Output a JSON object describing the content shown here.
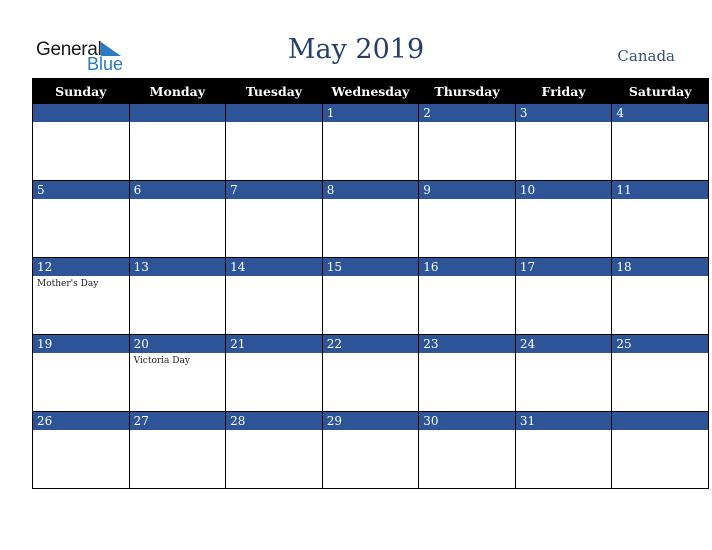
{
  "logo": {
    "line1": "General",
    "line2": "Blue"
  },
  "header": {
    "title": "May 2019",
    "country": "Canada"
  },
  "weekdays": [
    "Sunday",
    "Monday",
    "Tuesday",
    "Wednesday",
    "Thursday",
    "Friday",
    "Saturday"
  ],
  "weeks": [
    [
      {
        "day": "",
        "event": ""
      },
      {
        "day": "",
        "event": ""
      },
      {
        "day": "",
        "event": ""
      },
      {
        "day": "1",
        "event": ""
      },
      {
        "day": "2",
        "event": ""
      },
      {
        "day": "3",
        "event": ""
      },
      {
        "day": "4",
        "event": ""
      }
    ],
    [
      {
        "day": "5",
        "event": ""
      },
      {
        "day": "6",
        "event": ""
      },
      {
        "day": "7",
        "event": ""
      },
      {
        "day": "8",
        "event": ""
      },
      {
        "day": "9",
        "event": ""
      },
      {
        "day": "10",
        "event": ""
      },
      {
        "day": "11",
        "event": ""
      }
    ],
    [
      {
        "day": "12",
        "event": "Mother's Day"
      },
      {
        "day": "13",
        "event": ""
      },
      {
        "day": "14",
        "event": ""
      },
      {
        "day": "15",
        "event": ""
      },
      {
        "day": "16",
        "event": ""
      },
      {
        "day": "17",
        "event": ""
      },
      {
        "day": "18",
        "event": ""
      }
    ],
    [
      {
        "day": "19",
        "event": ""
      },
      {
        "day": "20",
        "event": "Victoria Day"
      },
      {
        "day": "21",
        "event": ""
      },
      {
        "day": "22",
        "event": ""
      },
      {
        "day": "23",
        "event": ""
      },
      {
        "day": "24",
        "event": ""
      },
      {
        "day": "25",
        "event": ""
      }
    ],
    [
      {
        "day": "26",
        "event": ""
      },
      {
        "day": "27",
        "event": ""
      },
      {
        "day": "28",
        "event": ""
      },
      {
        "day": "29",
        "event": ""
      },
      {
        "day": "30",
        "event": ""
      },
      {
        "day": "31",
        "event": ""
      },
      {
        "day": "",
        "event": ""
      }
    ]
  ],
  "colors": {
    "title": "#253f6b",
    "band": "#2d5496",
    "header_bg": "#000000",
    "logo_blue": "#2a7bc4"
  }
}
